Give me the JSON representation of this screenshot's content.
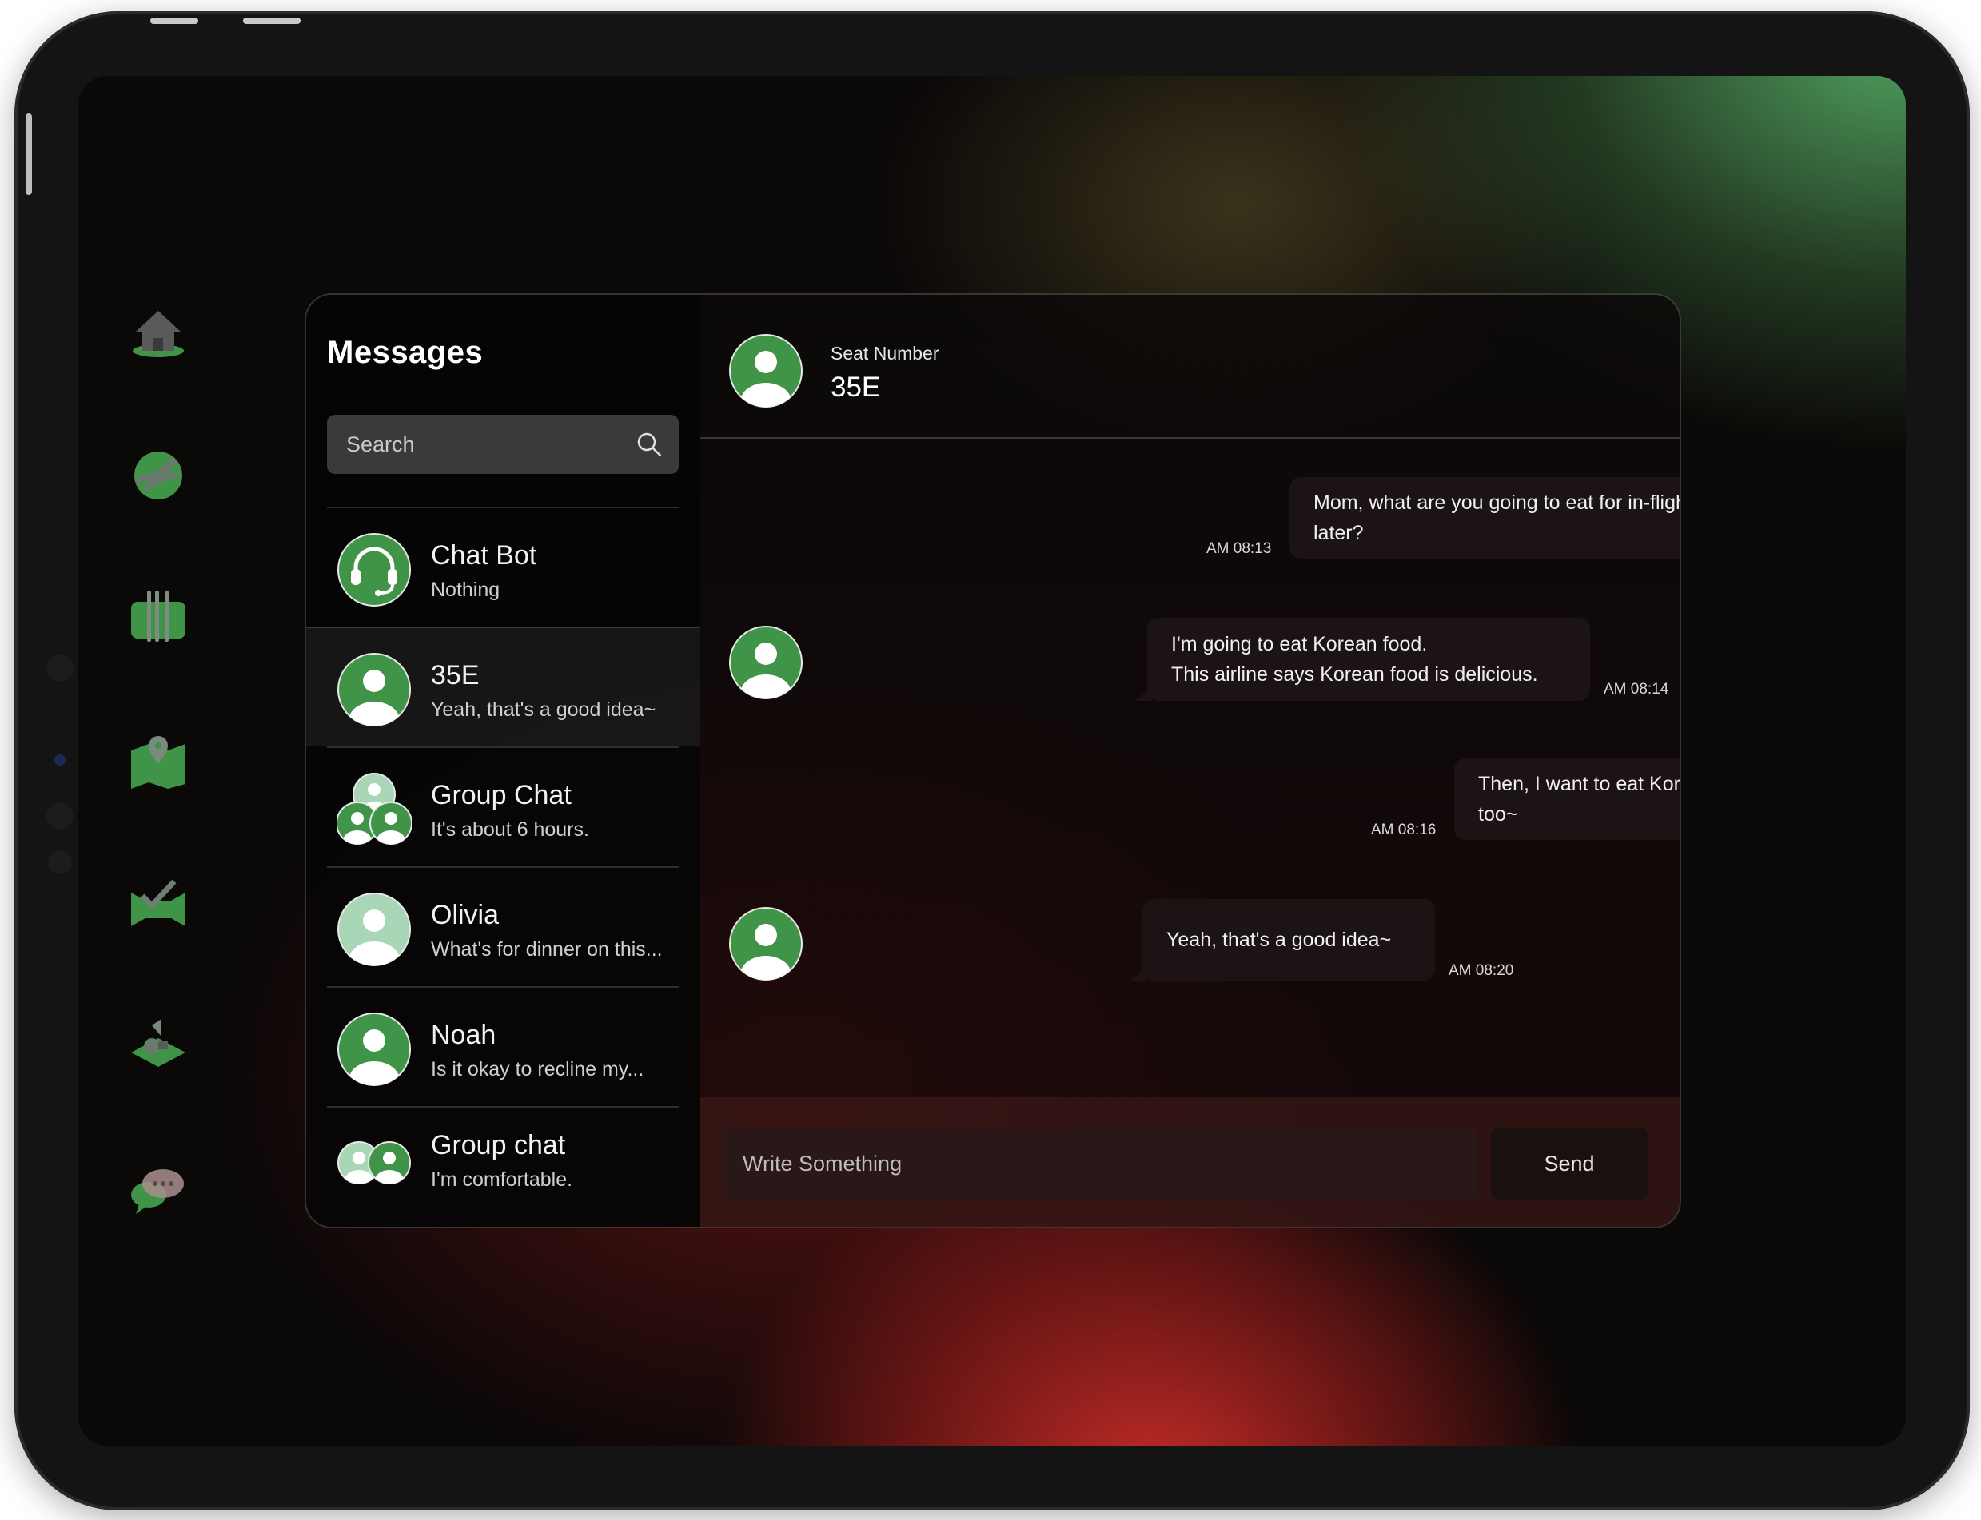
{
  "messages_panel": {
    "title": "Messages",
    "search": {
      "placeholder": "Search"
    }
  },
  "contacts": [
    {
      "name": "Chat Bot",
      "preview": "Nothing",
      "avatar": "headset-icon"
    },
    {
      "name": "35E",
      "preview": "Yeah, that's a good idea~",
      "avatar": "user-icon"
    },
    {
      "name": "Group Chat",
      "preview": "It's about 6 hours.",
      "avatar": "group-icon"
    },
    {
      "name": "Olivia",
      "preview": "What's for dinner on this...",
      "avatar": "user-icon"
    },
    {
      "name": "Noah",
      "preview": "Is it okay to recline my...",
      "avatar": "user-icon"
    },
    {
      "name": "Group chat",
      "preview": "I'm comfortable.",
      "avatar": "pair-icon"
    }
  ],
  "chat": {
    "header": {
      "label": "Seat Number",
      "value": "35E"
    },
    "messages": [
      {
        "direction": "out",
        "lines": [
          "Mom, what are you going to eat for in-flight food later?"
        ],
        "time": "AM 08:13"
      },
      {
        "direction": "in",
        "lines": [
          "I'm going to eat Korean food.",
          "This airline says Korean food is delicious."
        ],
        "time": "AM 08:14"
      },
      {
        "direction": "out",
        "lines": [
          "Then, I want to eat Korean food too~"
        ],
        "time": "AM 08:16"
      },
      {
        "direction": "in",
        "lines": [
          "Yeah, that's a good idea~"
        ],
        "time": "AM 08:20"
      }
    ],
    "composer": {
      "placeholder": "Write Something",
      "send_label": "Send"
    }
  },
  "colors": {
    "accent_green": "#3f9447",
    "avatar_light": "#a8d6b6",
    "bubble": "#1c1414"
  },
  "rail_icons": [
    "home-icon",
    "flight-icon",
    "dining-icon",
    "map-icon",
    "video-icon",
    "shopping-icon",
    "chat-icon"
  ]
}
